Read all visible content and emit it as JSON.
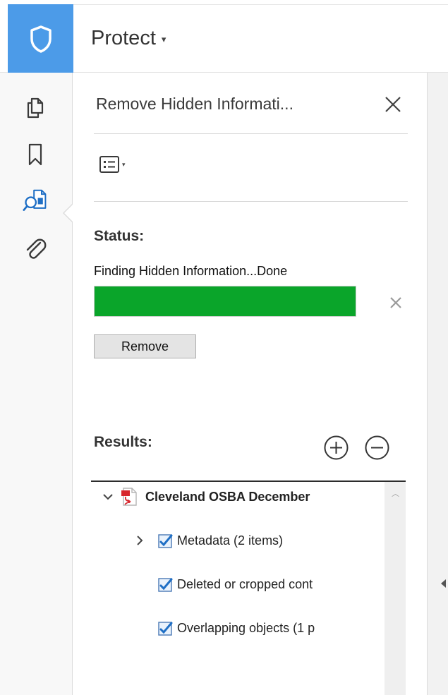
{
  "header": {
    "tool_name": "Protect",
    "caret": "▾"
  },
  "left_rail": {
    "items": [
      {
        "name": "pages-icon"
      },
      {
        "name": "bookmark-icon"
      },
      {
        "name": "search-document-icon",
        "active": true
      },
      {
        "name": "paperclip-icon"
      }
    ]
  },
  "panel": {
    "title": "Remove Hidden Informati...",
    "options_caret": "▾",
    "status": {
      "label": "Status:",
      "text": "Finding Hidden Information...Done",
      "progress_fraction": 1.0,
      "progress_color": "#0aa52a"
    },
    "remove_button": "Remove",
    "results": {
      "label": "Results:",
      "tree": {
        "root": "Cleveland OSBA December",
        "children": [
          {
            "label": "Metadata (2 items)",
            "expandable": true
          },
          {
            "label": "Deleted or cropped cont",
            "expandable": false
          },
          {
            "label": "Overlapping objects (1 p",
            "expandable": false
          }
        ]
      }
    }
  },
  "colors": {
    "accent": "#4c9be8",
    "progress": "#0aa52a",
    "pdf_red": "#d7262c"
  }
}
